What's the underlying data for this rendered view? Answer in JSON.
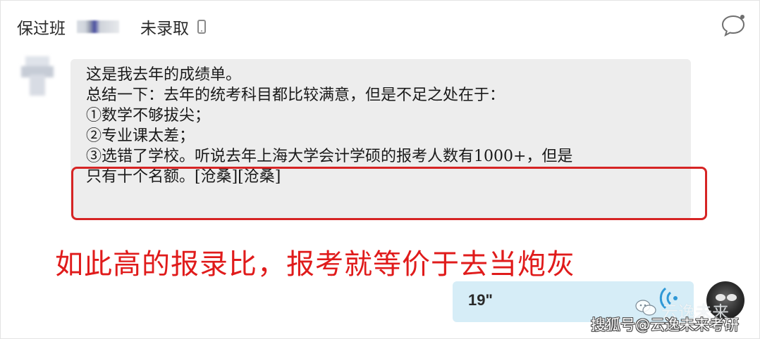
{
  "header": {
    "group_name": "保过班",
    "status": "未录取"
  },
  "message": {
    "lines": [
      "这是我去年的成绩单。",
      "总结一下：去年的统考科目都比较满意，但是不足之处在于：",
      "①数学不够拔尖；",
      "②专业课太差；",
      "③选错了学校。听说去年上海大学会计学硕的报考人数有1000+，但是",
      "只有十个名额。[沧桑][沧桑]"
    ]
  },
  "annotation": {
    "text": "如此高的报录比，报考就等价于去当炮灰"
  },
  "voice_message": {
    "duration": "19\""
  },
  "watermark": {
    "faded_text": "云逸未来",
    "text": "搜狐号@云逸未来考研"
  },
  "colors": {
    "highlight_red": "#d62424",
    "annotation_red": "#e01b1b",
    "message_bubble_bg": "#ededed",
    "voice_bubble_bg": "#d6edf7"
  },
  "icons": {
    "header_phone": "phone-icon",
    "header_right": "chat-bubble-icon",
    "voice": "voice-waves-icon",
    "watermark": "wechat-icon"
  }
}
